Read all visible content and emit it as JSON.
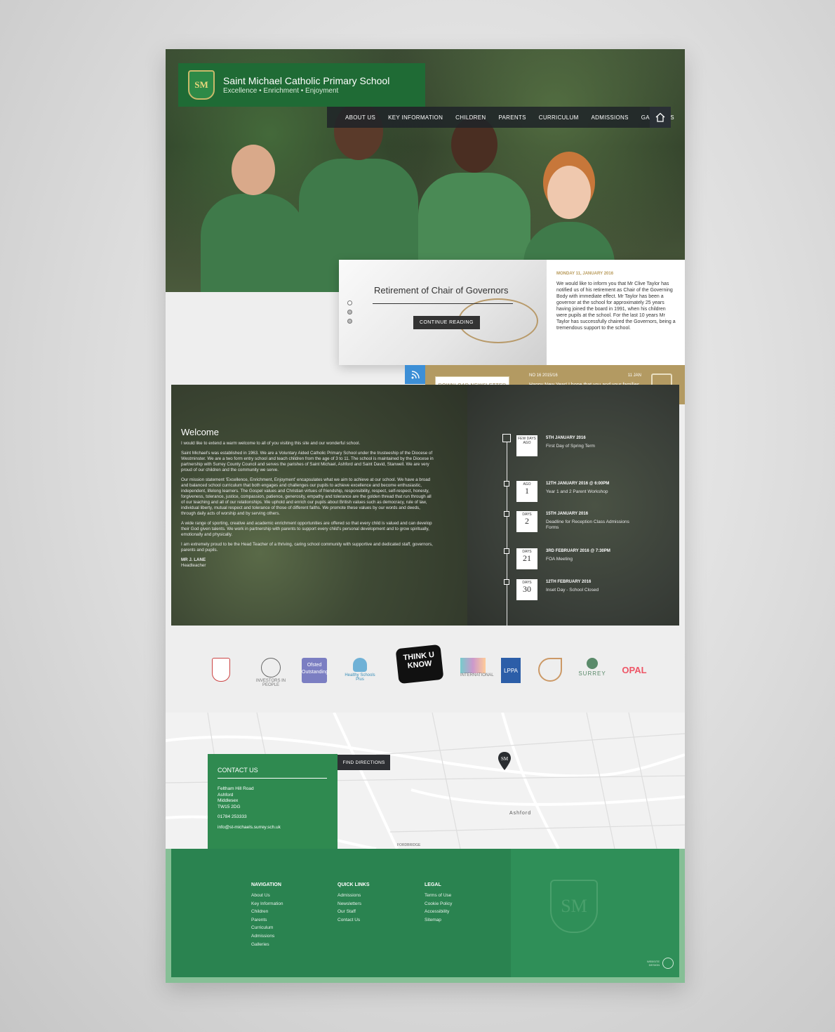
{
  "header": {
    "school_name": "Saint Michael Catholic Primary School",
    "tagline": "Excellence • Enrichment • Enjoyment",
    "crest_letters": "SM"
  },
  "nav": {
    "items": [
      "ABOUT US",
      "KEY INFORMATION",
      "CHILDREN",
      "PARENTS",
      "CURRICULUM",
      "ADMISSIONS",
      "GALLERIES"
    ],
    "home_icon": "home-icon"
  },
  "news": {
    "title": "Retirement of Chair of Governors",
    "button": "CONTINUE READING",
    "date": "MONDAY 11, JANUARY 2016",
    "body": "We would like to inform you that Mr Clive Taylor has notified us of his retirement as Chair of the Governing Body with immediate effect. Mr Taylor has been a governor at the school for approximately 25 years having joined the board in 1991, when his children were pupils at the school. For the last 10 years Mr Taylor has successfully chaired the Governors, being a tremendous support to the school."
  },
  "newsletter": {
    "button": "DOWNLOAD NEWSLETTER",
    "issue": "NO 16 2015/16",
    "date": "11 JAN",
    "body": "Happy New Year! I hope that you and your families managed to have a..."
  },
  "welcome": {
    "title": "Welcome",
    "paragraphs": [
      "I would like to extend a warm welcome to all of you visiting this site and our wonderful school.",
      "Saint Michael's was established in 1963. We are a Voluntary Aided Catholic Primary School under the trusteeship of the Diocese of Westminster. We are a two form entry school and teach children from the age of 3 to 11. The school is maintained by the Diocese in partnership with Surrey County Council and serves the parishes of Saint Michael, Ashford and Saint David, Stanwell. We are very proud of our children and the community we serve.",
      "Our mission statement 'Excellence, Enrichment, Enjoyment' encapsulates what we aim to achieve at our school. We have a broad and balanced school curriculum that both engages and challenges our pupils to achieve excellence and become enthusiastic, independent, lifelong learners. The Gospel values and Christian virtues of friendship, responsibility, respect, self-respect, honesty, forgiveness, tolerance, justice, compassion, patience, generosity, empathy and tolerance are the golden thread that run through all of our teaching and all of our relationships. We uphold and enrich our pupils about British values such as democracy, rule of law, individual liberty, mutual respect and tolerance of those of different faiths. We promote these values by our words and deeds, through daily acts of worship and by serving others.",
      "A wide range of sporting, creative and academic enrichment opportunities are offered so that every child is valued and can develop their God given talents. We work in partnership with parents to support every child's personal development and to grow spiritually, emotionally and physically.",
      "I am extremely proud to be the Head Teacher of a thriving, caring school community with supportive and dedicated staff, governors, parents and pupils."
    ],
    "signature": "MR J. LANE",
    "role": "Headteacher"
  },
  "events": [
    {
      "badge_top": "FEW DAYS",
      "num": "",
      "badge_bottom": "AGO",
      "date": "5TH JANUARY 2016",
      "title": "First Day of Spring Term"
    },
    {
      "badge_top": "AGO",
      "num": "1",
      "badge_bottom": "",
      "date": "12TH JANUARY 2016 @ 6:00PM",
      "title": "Year 1 and 2 Parent Workshop"
    },
    {
      "badge_top": "DAYS",
      "num": "2",
      "badge_bottom": "",
      "date": "15TH JANUARY 2016",
      "title": "Deadline for Reception Class Admissions Forms"
    },
    {
      "badge_top": "DAYS",
      "num": "21",
      "badge_bottom": "",
      "date": "3RD FEBRUARY 2016 @ 7:30PM",
      "title": "FOA Meeting"
    },
    {
      "badge_top": "DAYS",
      "num": "30",
      "badge_bottom": "",
      "date": "12TH FEBRUARY 2016",
      "title": "Inset Day - School Closed"
    }
  ],
  "logos": [
    {
      "name": "diocese-logo",
      "label": ""
    },
    {
      "name": "investors-logo",
      "label": "INVESTORS IN PEOPLE"
    },
    {
      "name": "ofsted-logo",
      "label": "Ofsted Outstanding"
    },
    {
      "name": "healthy-schools-logo",
      "label": "Healthy Schools Plus"
    },
    {
      "name": "thinkuknow-logo",
      "label": "THINK U KNOW"
    },
    {
      "name": "international-school-logo",
      "label": "INTERNATIONAL"
    },
    {
      "name": "lppa-logo",
      "label": "LPPA"
    },
    {
      "name": "artsmark-logo",
      "label": ""
    },
    {
      "name": "surrey-logo",
      "label": "SURREY"
    },
    {
      "name": "opal-logo",
      "label": "OPAL"
    }
  ],
  "contact": {
    "title": "CONTACT US",
    "address": [
      "Feltham Hill Road",
      "Ashford",
      "Middlesex",
      "TW15 2DG"
    ],
    "phone": "01784 253333",
    "email": "info@st-michaels.surrey.sch.uk",
    "directions_button": "FIND DIRECTIONS",
    "map_label": "Ashford",
    "map_label_2": "FORDBRIDGE"
  },
  "footer": {
    "navigation": {
      "title": "NAVIGATION",
      "items": [
        "About Us",
        "Key Information",
        "Children",
        "Parents",
        "Curriculum",
        "Admissions",
        "Galleries"
      ]
    },
    "quick_links": {
      "title": "QUICK LINKS",
      "items": [
        "Admissions",
        "Newsletters",
        "Our Staff",
        "Contact Us"
      ]
    },
    "legal": {
      "title": "LEGAL",
      "items": [
        "Terms of Use",
        "Cookie Policy",
        "Accessibility",
        "Sitemap"
      ]
    },
    "credit": "WEBSITE DESIGN"
  },
  "colors": {
    "primary_green": "#2a8350",
    "gold": "#b39a62",
    "rss_blue": "#3d8fd6",
    "dark_nav": "#2d2f33"
  }
}
